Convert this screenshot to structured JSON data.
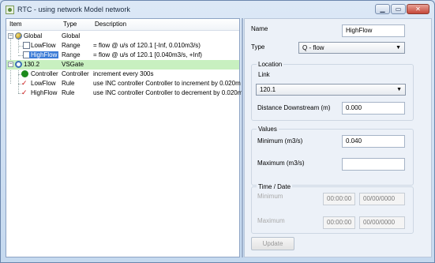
{
  "window": {
    "title": "RTC -  using network Model network"
  },
  "tree": {
    "headers": {
      "item": "Item",
      "type": "Type",
      "description": "Description"
    },
    "rows": [
      {
        "item": "Global",
        "type": "Global",
        "description": ""
      },
      {
        "item": "LowFlow",
        "type": "Range",
        "description": "= flow @ u/s of 120.1 [-Inf, 0.010m3/s)"
      },
      {
        "item": "HighFlow",
        "type": "Range",
        "description": "= flow @ u/s of 120.1 [0.040m3/s, +Inf)"
      },
      {
        "item": "130.2",
        "type": "VSGate",
        "description": ""
      },
      {
        "item": "Controller",
        "type": "Controller",
        "description": "increment every 300s"
      },
      {
        "item": "LowFlow",
        "type": "Rule",
        "description": "use INC controller Controller to increment by 0.020m"
      },
      {
        "item": "HighFlow",
        "type": "Rule",
        "description": "use INC controller Controller to decrement by 0.020m"
      }
    ]
  },
  "form": {
    "name_label": "Name",
    "name_value": "HighFlow",
    "type_label": "Type",
    "type_value": "Q - flow",
    "location_title": "Location",
    "link_label": "Link",
    "link_value": "120.1",
    "distance_label": "Distance Downstream (m)",
    "distance_value": "0.000",
    "values_title": "Values",
    "min_label": "Minimum (m3/s)",
    "min_value": "0.040",
    "max_label": "Maximum (m3/s)",
    "max_value": "",
    "time_title": "Time / Date",
    "time_min_label": "Minimum",
    "time_min_time": "00:00:00",
    "time_min_date": "00/00/0000",
    "time_max_label": "Maximum",
    "time_max_time": "00:00:00",
    "time_max_date": "00/00/0000",
    "update_label": "Update"
  },
  "icons": [
    "app-icon",
    "globe-icon",
    "range-icon",
    "gate-icon",
    "controller-icon",
    "rule-icon",
    "chevron-down-icon",
    "minimize-icon",
    "maximize-icon",
    "close-icon"
  ],
  "colors": {
    "selection": "#3b7bd6",
    "gate_row": "#c8f0c0",
    "rule_icon": "#d01818",
    "controller_icon": "#1d8a1d"
  }
}
